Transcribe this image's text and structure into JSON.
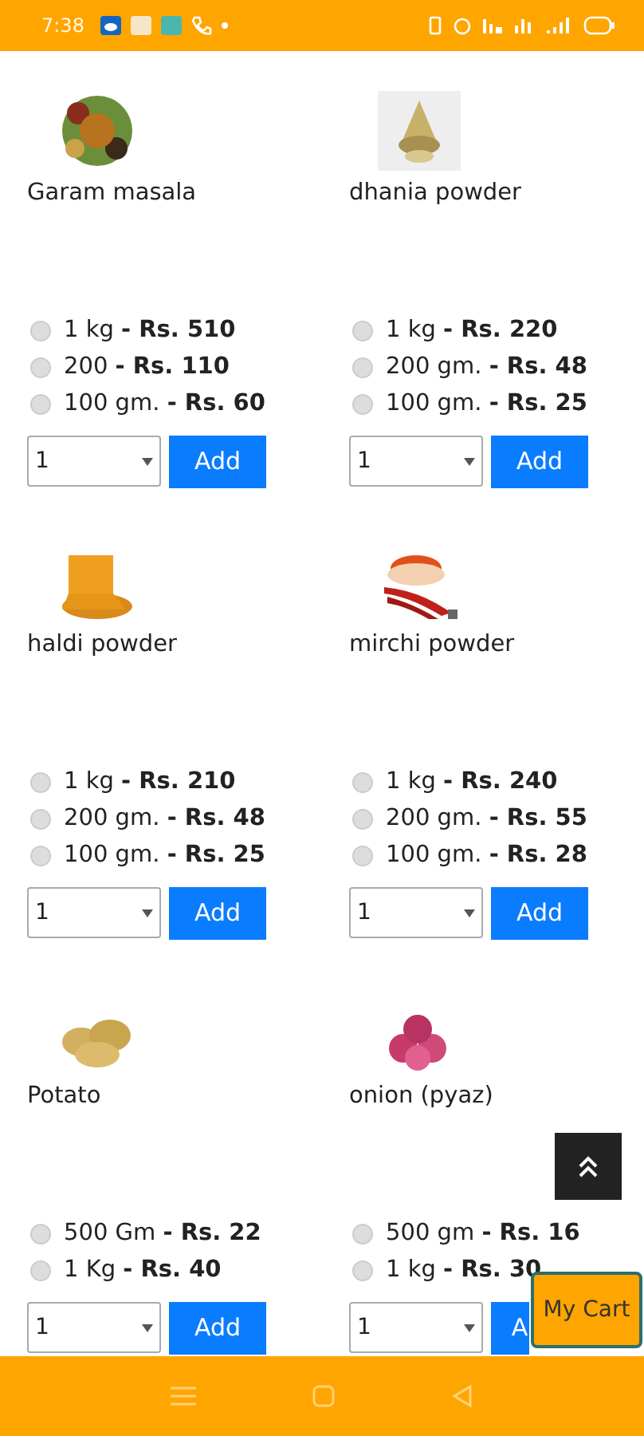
{
  "status_bar": {
    "time": "7:38"
  },
  "products": [
    {
      "name": "Garam masala",
      "options": [
        {
          "label": "1 kg  **- Rs. 510**",
          "selected": false
        },
        {
          "label": "200  **- Rs. 110**",
          "selected": false
        },
        {
          "label": "100 gm.  **- Rs. 60**",
          "selected": false
        }
      ],
      "quantity": "1",
      "button": "Add"
    },
    {
      "name": "dhania powder",
      "options": [
        {
          "label": "1 kg  **- Rs. 220**",
          "selected": false
        },
        {
          "label": "200 gm.  **- Rs. 48**",
          "selected": false
        },
        {
          "label": "100 gm.  **- Rs. 25**",
          "selected": false
        }
      ],
      "quantity": "1",
      "button": "Add"
    },
    {
      "name": "haldi powder",
      "options": [
        {
          "label": "1 kg  **- Rs. 210**",
          "selected": false
        },
        {
          "label": "200 gm.  **- Rs. 48**",
          "selected": false
        },
        {
          "label": "100 gm.  **- Rs. 25**",
          "selected": false
        }
      ],
      "quantity": "1",
      "button": "Add"
    },
    {
      "name": "mirchi powder",
      "options": [
        {
          "label": "1 kg  **- Rs. 240**",
          "selected": false
        },
        {
          "label": "200 gm.  **- Rs. 55**",
          "selected": false
        },
        {
          "label": "100 gm.  **- Rs. 28**",
          "selected": false
        }
      ],
      "quantity": "1",
      "button": "Add"
    },
    {
      "name": "Potato",
      "options": [
        {
          "label": "500 Gm  **- Rs. 22**",
          "selected": false
        },
        {
          "label": "1 Kg  **- Rs. 40**",
          "selected": false
        }
      ],
      "quantity": "1",
      "button": "Add"
    },
    {
      "name": "onion (pyaz)",
      "options": [
        {
          "label": "500 gm  **- Rs. 16**",
          "selected": false
        },
        {
          "label": "1 kg  **- Rs. 30**",
          "selected": false
        }
      ],
      "quantity": "1",
      "button": "A"
    }
  ],
  "cart_button": {
    "label": "My Cart"
  }
}
